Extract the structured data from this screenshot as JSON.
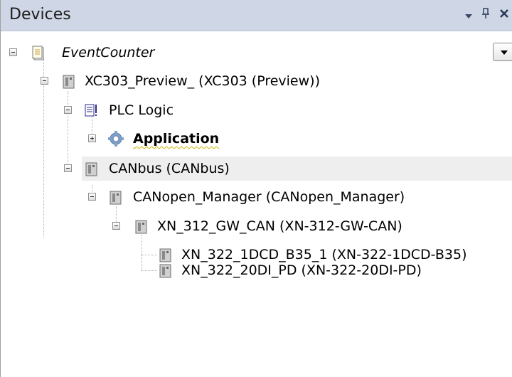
{
  "panel": {
    "title": "Devices",
    "buttons": {
      "dropdown": "▾",
      "pin": "ᵖ",
      "close": "✕"
    }
  },
  "tree": {
    "nodes": [
      {
        "label": "EventCounter",
        "icon": "project-icon",
        "expanded": true
      },
      {
        "label": "XC303_Preview_ (XC303 (Preview))",
        "icon": "device-icon",
        "expanded": true
      },
      {
        "label": "PLC Logic",
        "icon": "plc-logic-icon",
        "expanded": true
      },
      {
        "label": "Application",
        "icon": "application-gear-icon",
        "expanded": false
      },
      {
        "label": "CANbus (CANbus)",
        "icon": "device-icon",
        "expanded": true
      },
      {
        "label": "CANopen_Manager (CANopen_Manager)",
        "icon": "device-icon",
        "expanded": true
      },
      {
        "label": "XN_312_GW_CAN (XN-312-GW-CAN)",
        "icon": "device-icon",
        "expanded": true
      },
      {
        "label": "XN_322_1DCD_B35_1 (XN-322-1DCD-B35)",
        "icon": "device-icon"
      },
      {
        "label": "XN_322_20DI_PD (XN-322-20DI-PD)",
        "icon": "device-icon"
      }
    ]
  },
  "colors": {
    "titlebar": "#cfd6e5",
    "row_highlight": "#eeeeee",
    "device_icon": "#9a9a9a"
  }
}
